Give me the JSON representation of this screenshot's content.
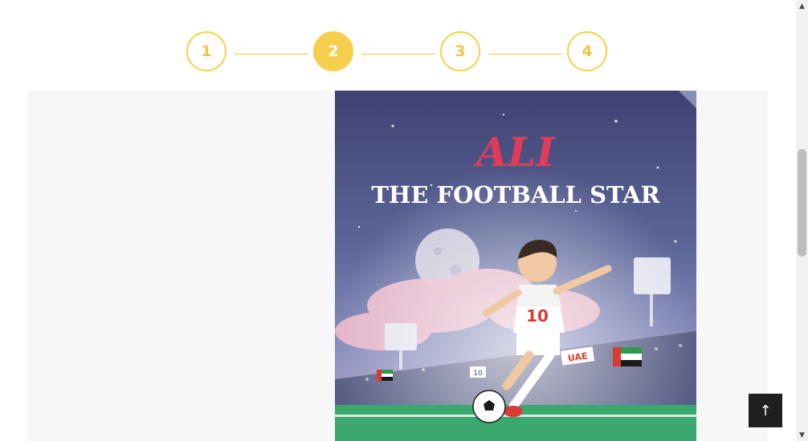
{
  "stepper": {
    "steps": [
      {
        "label": "1",
        "active": false
      },
      {
        "label": "2",
        "active": true
      },
      {
        "label": "3",
        "active": false
      },
      {
        "label": "4",
        "active": false
      }
    ],
    "accent_color": "#f7cf4f"
  },
  "book": {
    "title_line1": "ALI",
    "title_line2": "THE FOOTBALL STAR",
    "jersey_number": "10",
    "banner_text": "UAE",
    "board_number": "10"
  },
  "back_to_top": {
    "icon": "arrow-up-icon",
    "glyph": "↑"
  },
  "scrollbar": {
    "up_glyph": "▲",
    "down_glyph": "▼"
  }
}
